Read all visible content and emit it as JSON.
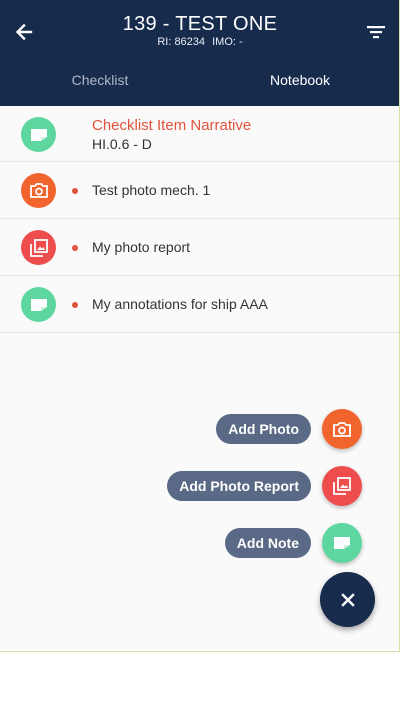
{
  "header": {
    "title": "139 - TEST ONE",
    "ri_label": "RI: 86234",
    "imo_label": "IMO: -"
  },
  "tabs": [
    {
      "label": "Checklist",
      "active": false
    },
    {
      "label": "Notebook",
      "active": true
    }
  ],
  "items": [
    {
      "title": "Checklist Item Narrative",
      "subtitle": "HI.0.6 - D",
      "icon": "note-icon",
      "color": "#5dd6a0"
    },
    {
      "label": "Test photo mech. 1",
      "icon": "camera-icon",
      "color": "#f2642e"
    },
    {
      "label": "My photo report",
      "icon": "photo-report-icon",
      "color": "#ee4d4d"
    },
    {
      "label": "My annotations for ship AAA",
      "icon": "note-icon",
      "color": "#5dd6a0"
    }
  ],
  "fab_menu": {
    "add_photo": "Add Photo",
    "add_photo_report": "Add Photo Report",
    "add_note": "Add Note"
  },
  "colors": {
    "appbar": "#172b4d",
    "note": "#5dd6a0",
    "camera": "#f2642e",
    "photo_report": "#ee4d4d",
    "unread_dot": "#e0533c",
    "label_pill": "#5a6985"
  },
  "icons": {
    "back": "arrow-left-icon",
    "filter": "filter-icon",
    "close": "close-icon"
  }
}
